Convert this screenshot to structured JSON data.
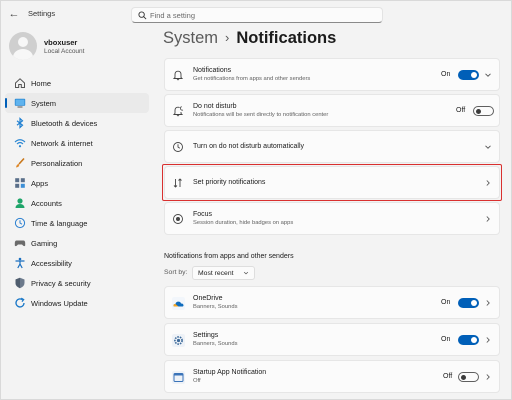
{
  "window": {
    "app_title": "Settings"
  },
  "search": {
    "placeholder": "Find a setting"
  },
  "profile": {
    "name": "vboxuser",
    "account_type": "Local Account"
  },
  "sidebar": {
    "items": [
      {
        "label": "Home",
        "icon": "home-icon"
      },
      {
        "label": "System",
        "icon": "system-icon",
        "active": true
      },
      {
        "label": "Bluetooth & devices",
        "icon": "bluetooth-icon"
      },
      {
        "label": "Network & internet",
        "icon": "wifi-icon"
      },
      {
        "label": "Personalization",
        "icon": "brush-icon"
      },
      {
        "label": "Apps",
        "icon": "apps-icon"
      },
      {
        "label": "Accounts",
        "icon": "accounts-icon"
      },
      {
        "label": "Time & language",
        "icon": "globe-clock-icon"
      },
      {
        "label": "Gaming",
        "icon": "gamepad-icon"
      },
      {
        "label": "Accessibility",
        "icon": "accessibility-icon"
      },
      {
        "label": "Privacy & security",
        "icon": "shield-icon"
      },
      {
        "label": "Windows Update",
        "icon": "update-icon"
      }
    ]
  },
  "breadcrumb": {
    "parent": "System",
    "separator": "›",
    "current": "Notifications"
  },
  "cards": {
    "notifications": {
      "title": "Notifications",
      "subtitle": "Get notifications from apps and other senders",
      "toggle_label": "On",
      "toggle_on": true
    },
    "do_not_disturb": {
      "title": "Do not disturb",
      "subtitle": "Notifications will be sent directly to notification center",
      "toggle_label": "Off",
      "toggle_on": false
    },
    "auto_dnd": {
      "title": "Turn on do not disturb automatically"
    },
    "priority": {
      "title": "Set priority notifications"
    },
    "focus": {
      "title": "Focus",
      "subtitle": "Session duration, hide badges on apps"
    }
  },
  "apps_section": {
    "title": "Notifications from apps and other senders",
    "sort_label": "Sort by:",
    "sort_value": "Most recent",
    "apps": [
      {
        "name": "OneDrive",
        "detail": "Banners, Sounds",
        "toggle_label": "On",
        "toggle_on": true,
        "icon": "onedrive-icon"
      },
      {
        "name": "Settings",
        "detail": "Banners, Sounds",
        "toggle_label": "On",
        "toggle_on": true,
        "icon": "settings-gear-icon"
      },
      {
        "name": "Startup App Notification",
        "detail": "Off",
        "toggle_label": "Off",
        "toggle_on": false,
        "icon": "startup-app-icon"
      }
    ]
  },
  "colors": {
    "accent": "#005fb8",
    "highlight_border": "#d9302f"
  }
}
